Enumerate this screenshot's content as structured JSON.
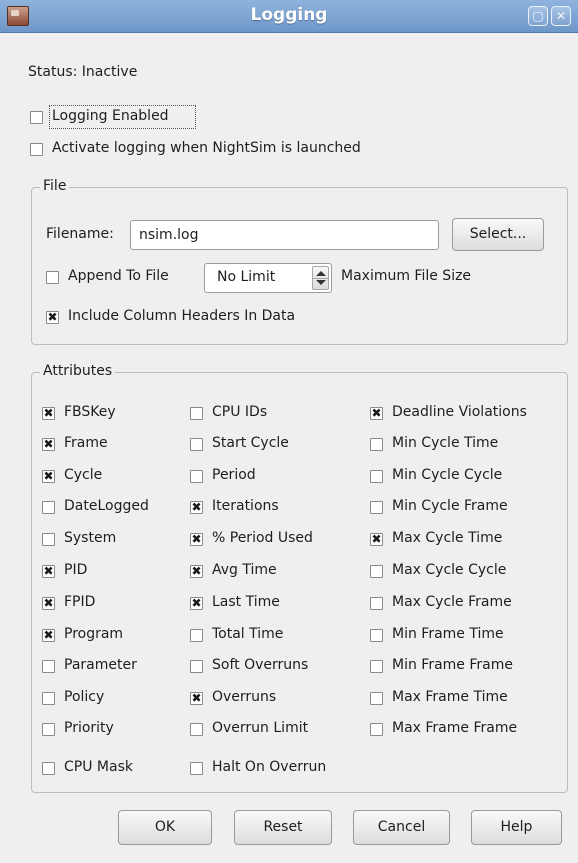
{
  "window": {
    "title": "Logging",
    "icons": [
      "app-icon",
      "maximize-icon",
      "close-icon"
    ]
  },
  "status_text": "Status: Inactive",
  "options": {
    "logging_enabled": {
      "label": "Logging Enabled",
      "checked": false
    },
    "activate_on_launch": {
      "label": "Activate logging when NightSim is launched",
      "checked": false
    }
  },
  "file_group": {
    "title": "File",
    "filename_label": "Filename:",
    "filename_value": "nsim.log",
    "select_button": "Select...",
    "append_label": "Append To File",
    "append_checked": false,
    "max_size_value": "No Limit",
    "max_size_label": "Maximum File Size",
    "headers_label": "Include Column Headers In Data",
    "headers_checked": true
  },
  "attributes": {
    "title": "Attributes",
    "columns": [
      [
        {
          "label": "FBSKey",
          "checked": true
        },
        {
          "label": "Frame",
          "checked": true
        },
        {
          "label": "Cycle",
          "checked": true
        },
        {
          "label": "DateLogged",
          "checked": false
        },
        {
          "label": "System",
          "checked": false
        },
        {
          "label": "PID",
          "checked": true
        },
        {
          "label": "FPID",
          "checked": true
        },
        {
          "label": "Program",
          "checked": true
        },
        {
          "label": "Parameter",
          "checked": false
        },
        {
          "label": "Policy",
          "checked": false
        },
        {
          "label": "Priority",
          "checked": false
        },
        {
          "label": "CPU Mask",
          "checked": false
        }
      ],
      [
        {
          "label": "CPU IDs",
          "checked": false
        },
        {
          "label": "Start Cycle",
          "checked": false
        },
        {
          "label": "Period",
          "checked": false
        },
        {
          "label": "Iterations",
          "checked": true
        },
        {
          "label": "% Period Used",
          "checked": true
        },
        {
          "label": "Avg Time",
          "checked": true
        },
        {
          "label": "Last Time",
          "checked": true
        },
        {
          "label": "Total Time",
          "checked": false
        },
        {
          "label": "Soft Overruns",
          "checked": false
        },
        {
          "label": "Overruns",
          "checked": true
        },
        {
          "label": "Overrun Limit",
          "checked": false
        },
        {
          "label": "Halt On Overrun",
          "checked": false
        }
      ],
      [
        {
          "label": "Deadline Violations",
          "checked": true
        },
        {
          "label": "Min Cycle Time",
          "checked": false
        },
        {
          "label": "Min Cycle Cycle",
          "checked": false
        },
        {
          "label": "Min Cycle Frame",
          "checked": false
        },
        {
          "label": "Max Cycle Time",
          "checked": true
        },
        {
          "label": "Max Cycle Cycle",
          "checked": false
        },
        {
          "label": "Max Cycle Frame",
          "checked": false
        },
        {
          "label": "Min Frame Time",
          "checked": false
        },
        {
          "label": "Min Frame Frame",
          "checked": false
        },
        {
          "label": "Max Frame Time",
          "checked": false
        },
        {
          "label": "Max Frame Frame",
          "checked": false
        }
      ]
    ]
  },
  "buttons": {
    "ok": "OK",
    "reset": "Reset",
    "cancel": "Cancel",
    "help": "Help"
  },
  "check_glyph": "✖"
}
